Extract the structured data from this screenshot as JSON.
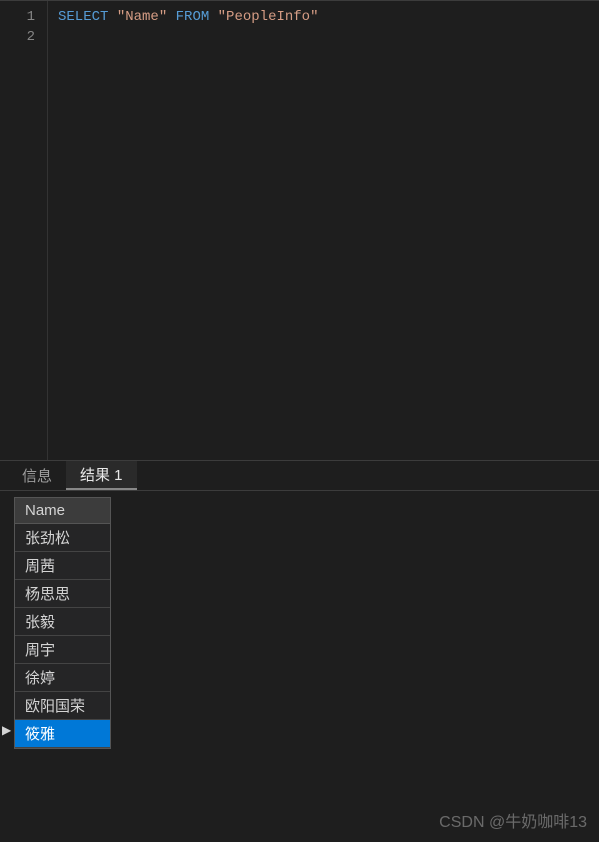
{
  "editor": {
    "lines": [
      {
        "number": "1",
        "tokens": [
          {
            "type": "keyword",
            "text": "SELECT "
          },
          {
            "type": "string",
            "text": "\"Name\""
          },
          {
            "type": "plain",
            "text": " "
          },
          {
            "type": "keyword",
            "text": "FROM "
          },
          {
            "type": "string",
            "text": "\"PeopleInfo\""
          }
        ]
      },
      {
        "number": "2",
        "tokens": []
      }
    ]
  },
  "tabs": {
    "info": "信息",
    "result": "结果 1",
    "active": "result"
  },
  "results": {
    "column": "Name",
    "rows": [
      {
        "value": "张劲松",
        "selected": false
      },
      {
        "value": "周茜",
        "selected": false
      },
      {
        "value": "杨思思",
        "selected": false
      },
      {
        "value": "张毅",
        "selected": false
      },
      {
        "value": "周宇",
        "selected": false
      },
      {
        "value": "徐婷",
        "selected": false
      },
      {
        "value": "欧阳国荣",
        "selected": false
      },
      {
        "value": "筱雅",
        "selected": true
      }
    ]
  },
  "watermark": "CSDN @牛奶咖啡13"
}
